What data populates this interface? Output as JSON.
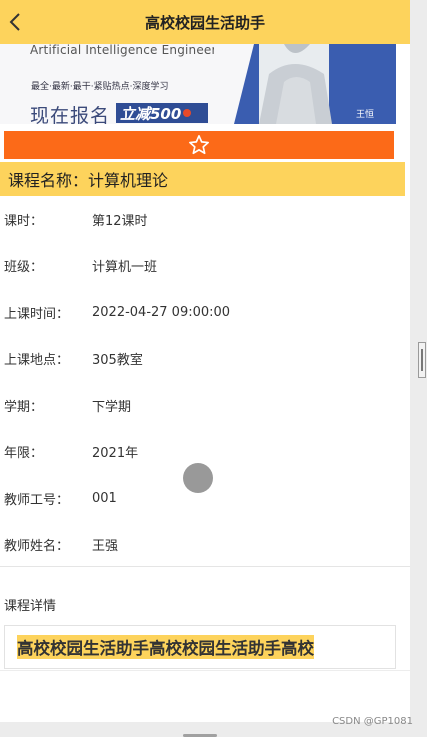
{
  "header": {
    "title": "高校校园生活助手",
    "back_icon": "chevron-left-icon"
  },
  "banner": {
    "subtitle": "Artificial Intelligence Engineer",
    "tags": "最全·最新·最干·紧贴热点·深度学习",
    "cta": "现在报名",
    "badge": "立减500",
    "teacher": "王恒"
  },
  "favorite": {
    "icon": "star-icon",
    "color": "#fc6a18"
  },
  "course": {
    "title": "课程名称：计算机理论",
    "fields": [
      {
        "label": "课时：",
        "value": "第12课时"
      },
      {
        "label": "班级：",
        "value": "计算机一班"
      },
      {
        "label": "上课时间：",
        "value": "2022-04-27 09:00:00"
      },
      {
        "label": "上课地点：",
        "value": "305教室"
      },
      {
        "label": "学期：",
        "value": "下学期"
      },
      {
        "label": "年限：",
        "value": "2021年"
      },
      {
        "label": "教师工号：",
        "value": "001"
      },
      {
        "label": "教师姓名：",
        "value": "王强"
      }
    ],
    "detail_label": "课程详情",
    "detail_text": "高校校园生活助手高校校园生活助手高校"
  },
  "watermark": "CSDN @GP1081",
  "colors": {
    "accent": "#fdd35c",
    "favorite": "#fc6a18"
  }
}
